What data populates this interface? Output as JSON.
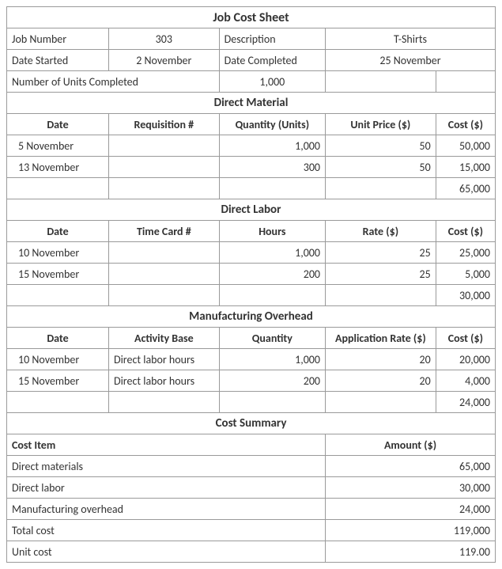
{
  "title": "Job Cost Sheet",
  "header": {
    "jobNumberLabel": "Job Number",
    "jobNumber": "303",
    "descriptionLabel": "Description",
    "description": "T-Shirts",
    "dateStartedLabel": "Date Started",
    "dateStarted": "2  November",
    "dateCompletedLabel": "Date Completed",
    "dateCompleted": "25 November",
    "unitsCompletedLabel": "Number of Units Completed",
    "unitsCompleted": "1,000"
  },
  "directMaterial": {
    "section": "Direct Material",
    "cols": {
      "date": "Date",
      "requisition": "Requisition #",
      "quantity": "Quantity (Units)",
      "unitPrice": "Unit  Price ($)",
      "cost": "Cost ($)"
    },
    "rows": [
      {
        "date": "5 November",
        "requisition": "",
        "quantity": "1,000",
        "unitPrice": "50",
        "cost": "50,000"
      },
      {
        "date": "13 November",
        "requisition": "",
        "quantity": "300",
        "unitPrice": "50",
        "cost": "15,000"
      }
    ],
    "total": "65,000"
  },
  "directLabor": {
    "section": "Direct Labor",
    "cols": {
      "date": "Date",
      "timeCard": "Time Card #",
      "hours": "Hours",
      "rate": "Rate ($)",
      "cost": "Cost ($)"
    },
    "rows": [
      {
        "date": "10 November",
        "timeCard": "",
        "hours": "1,000",
        "rate": "25",
        "cost": "25,000"
      },
      {
        "date": "15 November",
        "timeCard": "",
        "hours": "200",
        "rate": "25",
        "cost": "5,000"
      }
    ],
    "total": "30,000"
  },
  "overhead": {
    "section": "Manufacturing Overhead",
    "cols": {
      "date": "Date",
      "activityBase": "Activity Base",
      "quantity": "Quantity",
      "appRate": "Application Rate ($)",
      "cost": "Cost ($)"
    },
    "rows": [
      {
        "date": "10 November",
        "activityBase": "Direct labor hours",
        "quantity": "1,000",
        "appRate": "20",
        "cost": "20,000"
      },
      {
        "date": "15 November",
        "activityBase": "Direct labor hours",
        "quantity": "200",
        "appRate": "20",
        "cost": "4,000"
      }
    ],
    "total": "24,000"
  },
  "summary": {
    "section": "Cost Summary",
    "cols": {
      "item": "Cost Item",
      "amount": "Amount ($)"
    },
    "rows": [
      {
        "item": "Direct materials",
        "amount": "65,000"
      },
      {
        "item": "Direct labor",
        "amount": "30,000"
      },
      {
        "item": "Manufacturing overhead",
        "amount": "24,000"
      },
      {
        "item": "Total cost",
        "amount": "119,000"
      },
      {
        "item": "Unit cost",
        "amount": "119.00"
      }
    ]
  }
}
